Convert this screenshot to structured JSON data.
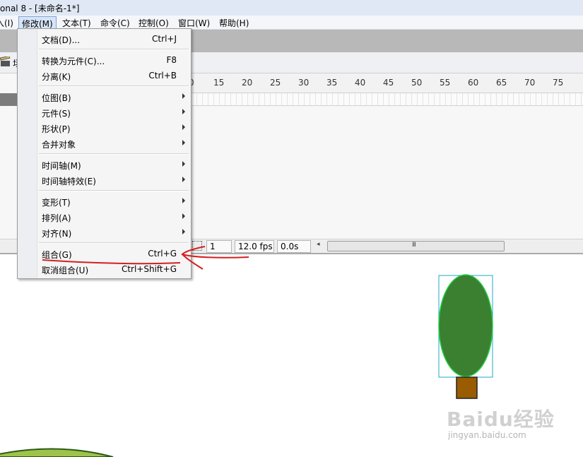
{
  "window": {
    "title": "onal 8 - [未命名-1*]"
  },
  "menubar": {
    "items": [
      {
        "label": "入(I)",
        "open": false
      },
      {
        "label": "修改(M)",
        "open": true
      },
      {
        "label": "文本(T)",
        "open": false
      },
      {
        "label": "命令(C)",
        "open": false
      },
      {
        "label": "控制(O)",
        "open": false
      },
      {
        "label": "窗口(W)",
        "open": false
      },
      {
        "label": "帮助(H)",
        "open": false
      }
    ]
  },
  "edit_bar": {
    "scene_label": "场"
  },
  "modify_menu": {
    "items": [
      {
        "label": "文档(D)...",
        "shortcut": "Ctrl+J",
        "submenu": false
      },
      {
        "label": "转换为元件(C)...",
        "shortcut": "F8",
        "submenu": false
      },
      {
        "label": "分离(K)",
        "shortcut": "Ctrl+B",
        "submenu": false
      },
      {
        "label": "位图(B)",
        "shortcut": "",
        "submenu": true
      },
      {
        "label": "元件(S)",
        "shortcut": "",
        "submenu": true
      },
      {
        "label": "形状(P)",
        "shortcut": "",
        "submenu": true
      },
      {
        "label": "合并对象",
        "shortcut": "",
        "submenu": true
      },
      {
        "label": "时间轴(M)",
        "shortcut": "",
        "submenu": true
      },
      {
        "label": "时间轴特效(E)",
        "shortcut": "",
        "submenu": true
      },
      {
        "label": "变形(T)",
        "shortcut": "",
        "submenu": true
      },
      {
        "label": "排列(A)",
        "shortcut": "",
        "submenu": true
      },
      {
        "label": "对齐(N)",
        "shortcut": "",
        "submenu": true
      },
      {
        "label": "组合(G)",
        "shortcut": "Ctrl+G",
        "submenu": false
      },
      {
        "label": "取消组合(U)",
        "shortcut": "Ctrl+Shift+G",
        "submenu": false
      }
    ]
  },
  "timeline": {
    "ruler_ticks": [
      "0",
      "15",
      "20",
      "25",
      "30",
      "35",
      "40",
      "45",
      "50",
      "55",
      "60",
      "65",
      "70",
      "75"
    ],
    "current_frame": "1",
    "frame_rate": "12.0 fps",
    "elapsed_time": "0.0s",
    "scroll_grip": "III"
  },
  "stage": {
    "tree_crown_color": "#3a8030",
    "tree_outline_color": "#22cc44",
    "tree_trunk_color": "#9a5c00",
    "selection_box_color": "#22a8c8",
    "ground_color": "#9fc24a"
  },
  "annotation": {
    "color": "#d42020"
  },
  "watermark": {
    "brand": "Baidu经验",
    "url": "jingyan.baidu.com"
  }
}
